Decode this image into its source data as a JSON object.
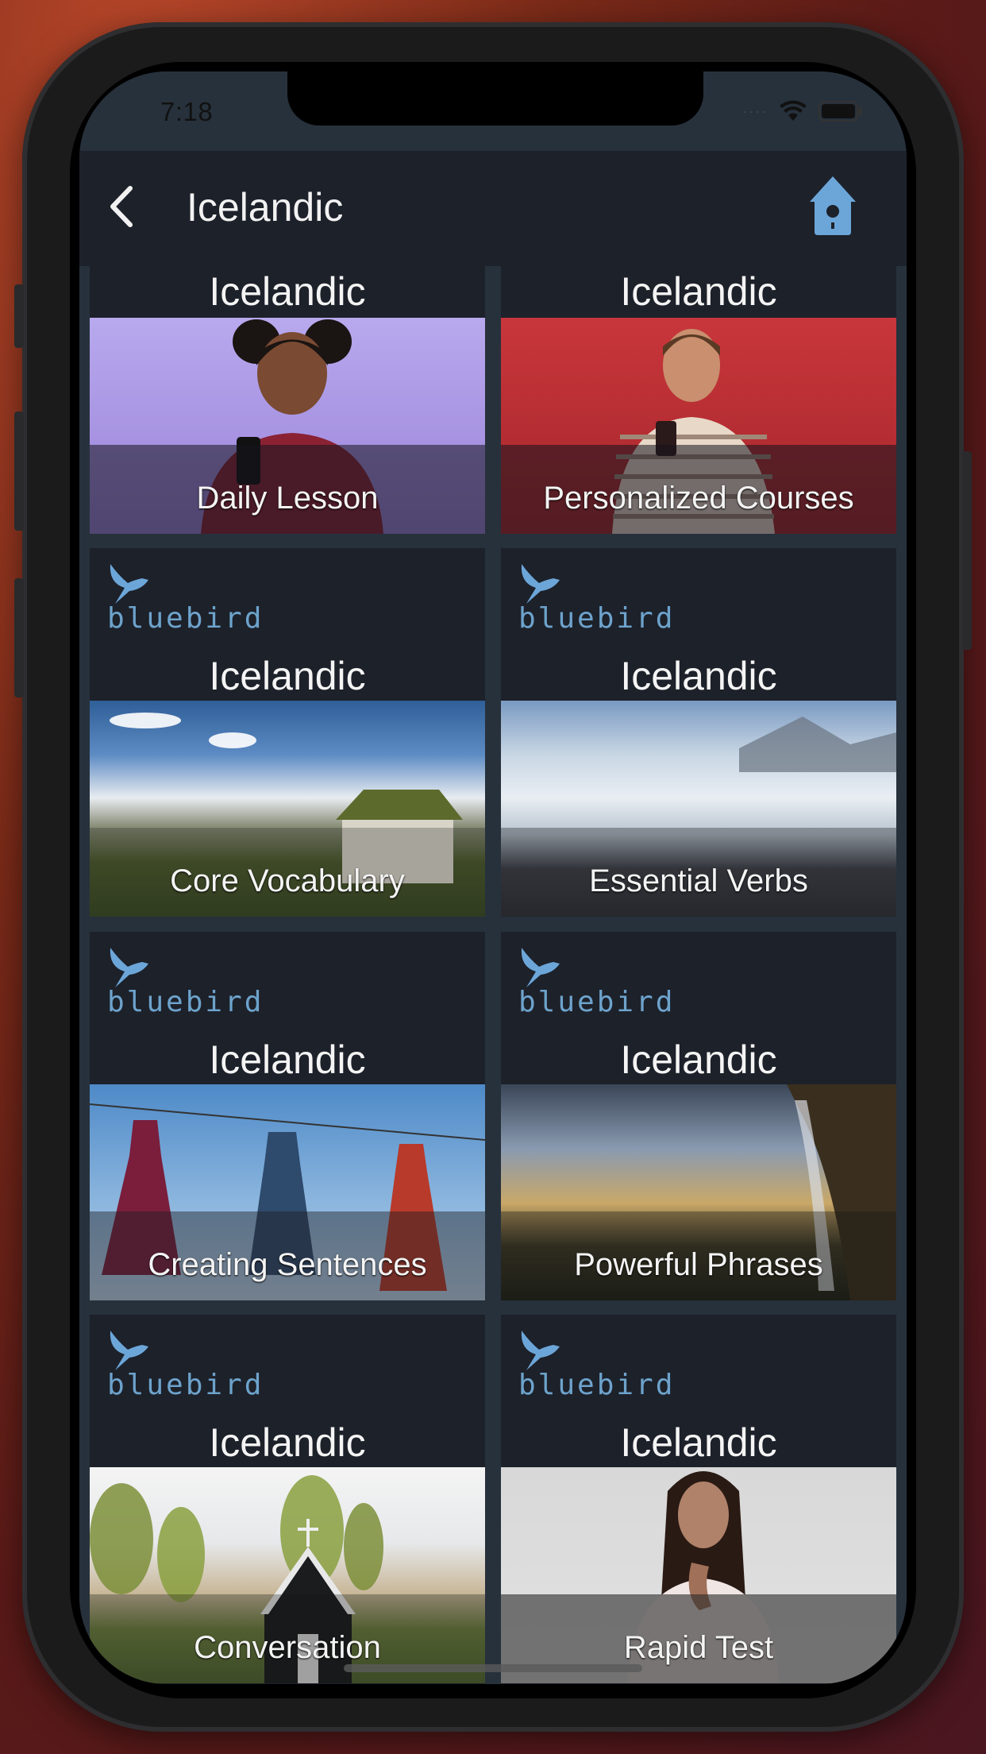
{
  "status_bar": {
    "time": "7:18",
    "signal_icon": "cellular-signal-icon",
    "wifi_icon": "wifi-icon",
    "battery_icon": "battery-icon"
  },
  "nav_bar": {
    "back_icon": "chevron-left-icon",
    "title": "Icelandic",
    "home_icon": "birdhouse-home-icon",
    "accent_color": "#6ca6d9"
  },
  "brand": {
    "name": "bluebird",
    "color": "#6da3cc"
  },
  "cards": [
    {
      "language": "Icelandic",
      "caption": "Daily Lesson",
      "has_logo": false
    },
    {
      "language": "Icelandic",
      "caption": "Personalized Courses",
      "has_logo": false
    },
    {
      "language": "Icelandic",
      "caption": "Core Vocabulary",
      "has_logo": true
    },
    {
      "language": "Icelandic",
      "caption": "Essential Verbs",
      "has_logo": true
    },
    {
      "language": "Icelandic",
      "caption": "Creating Sentences",
      "has_logo": true
    },
    {
      "language": "Icelandic",
      "caption": "Powerful Phrases",
      "has_logo": true
    },
    {
      "language": "Icelandic",
      "caption": "Conversation",
      "has_logo": true
    },
    {
      "language": "Icelandic",
      "caption": "Rapid Test",
      "has_logo": true
    }
  ]
}
